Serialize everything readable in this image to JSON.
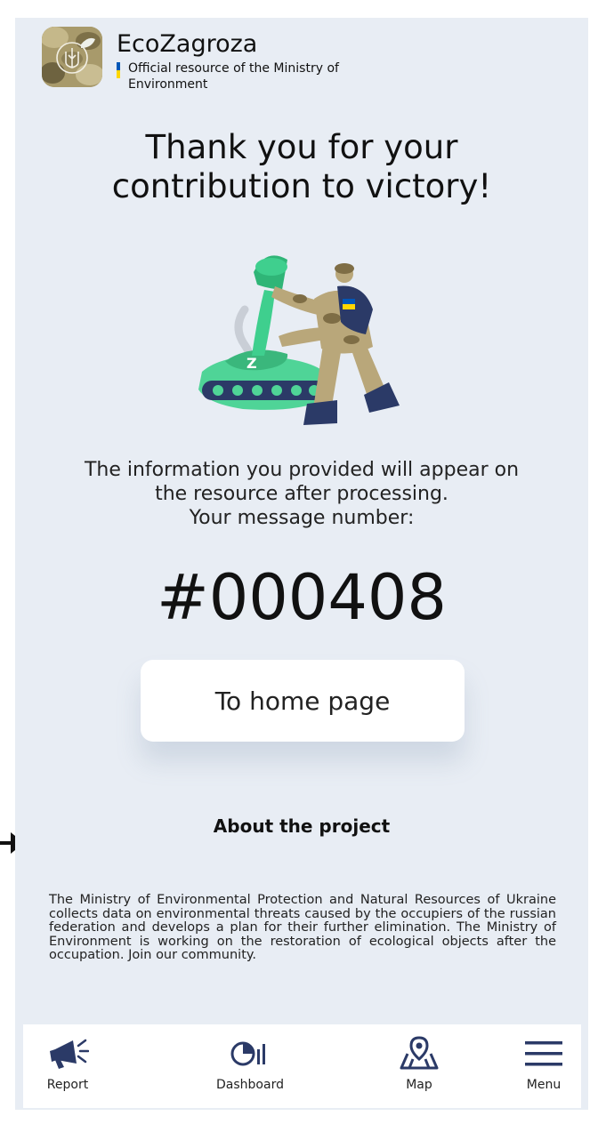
{
  "header": {
    "app_name": "EcoZagroza",
    "subtitle": "Official resource of the Ministry of Environment"
  },
  "headline": "Thank you for your contribution to victory!",
  "info": {
    "line1": "The information you provided will appear on",
    "line2": "the resource after processing.",
    "line3": "Your message number:"
  },
  "message_number": "#000408",
  "home_button_label": "To home page",
  "about": {
    "title": "About the project",
    "text": "The Ministry of Environmental Protection and Natural Resources of Ukraine collects data on environmental threats caused by the occupiers of the russian federation and develops a plan for their further elimination. The Ministry of Environment is working on the restoration of ecological objects after the occupation. Join our community."
  },
  "nav": {
    "items": [
      {
        "label": "Report",
        "icon": "megaphone-icon"
      },
      {
        "label": "Dashboard",
        "icon": "dashboard-icon"
      },
      {
        "label": "Map",
        "icon": "map-icon"
      },
      {
        "label": "Menu",
        "icon": "menu-icon"
      }
    ]
  },
  "colors": {
    "background": "#e8edf4",
    "navy": "#2b3a67",
    "tank_green": "#3fcf8e",
    "flag_blue": "#0057b7",
    "flag_yellow": "#ffd700"
  }
}
